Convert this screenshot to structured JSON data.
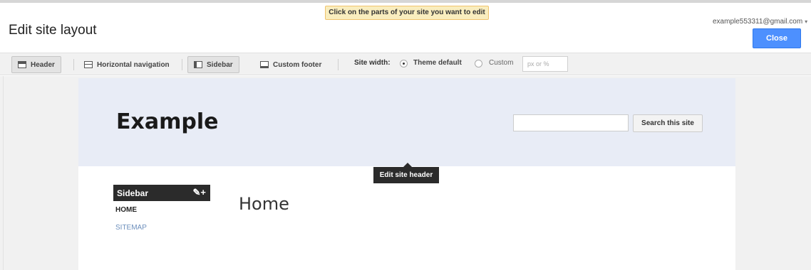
{
  "tip": "Click on the parts of your site you want to edit",
  "title": "Edit site layout",
  "account": "example553311@gmail.com",
  "close_label": "Close",
  "toolbar": {
    "header": "Header",
    "horizontal_nav": "Horizontal navigation",
    "sidebar": "Sidebar",
    "custom_footer": "Custom footer",
    "site_width_label": "Site width:",
    "theme_default": "Theme default",
    "custom": "Custom",
    "px_placeholder": "px or %"
  },
  "site": {
    "title": "Example",
    "search_button": "Search this site",
    "header_tooltip": "Edit site header",
    "sidebar_title": "Sidebar",
    "sidebar_items": [
      "HOME",
      "SITEMAP"
    ],
    "page_heading": "Home"
  },
  "colors": {
    "accent": "#4d90fe",
    "tip_bg": "#f9edbe",
    "header_bg": "#e8ecf6",
    "dark": "#2b2b2b",
    "link": "#6d8fbc"
  },
  "icons": [
    "header-layout-icon",
    "horizontal-nav-layout-icon",
    "sidebar-layout-icon",
    "footer-layout-icon",
    "pencil-icon",
    "plus-icon",
    "chevron-down-icon"
  ],
  "state": {
    "header_selected": true,
    "sidebar_selected": true,
    "site_width": "theme-default"
  }
}
